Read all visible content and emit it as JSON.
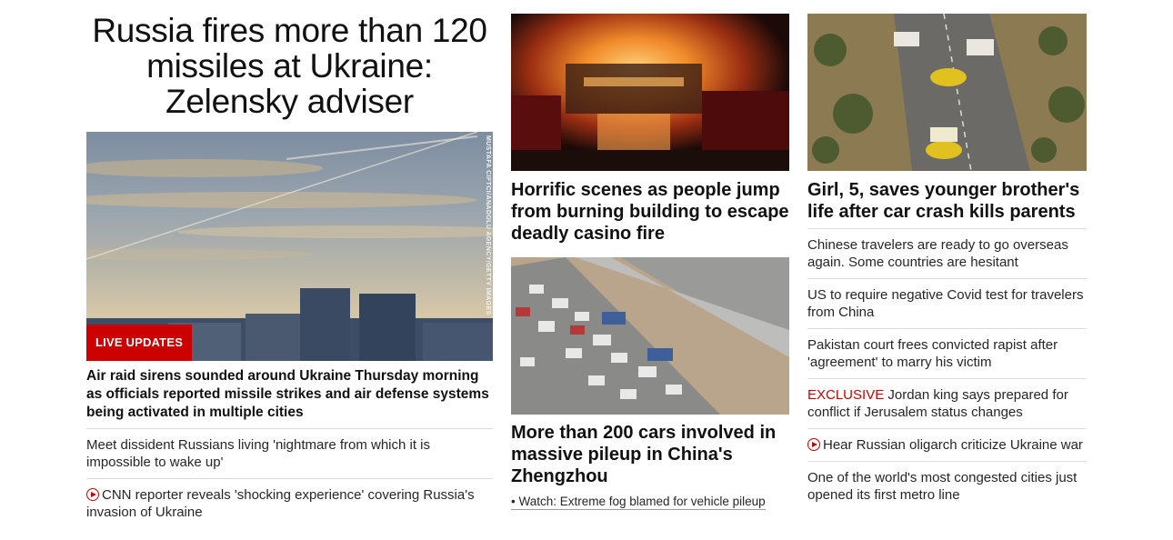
{
  "colors": {
    "accent_red": "#cc0000",
    "text": "#0c0c0c"
  },
  "col1": {
    "headline": "Russia fires more than 120 missiles at Ukraine: Zelensky adviser",
    "image_credit": "MUSTAFA CIFTCI/ANADOLU AGENCY/GETTY IMAGES",
    "badge": "LIVE UPDATES",
    "lead": "Air raid sirens sounded around Ukraine Thursday morning as officials reported missile strikes and air defense systems being activated in multiple cities",
    "stories": [
      "Meet dissident Russians living 'nightmare from which it is impossible to wake up'",
      "CNN reporter reveals 'shocking experience' covering Russia's invasion of Ukraine"
    ]
  },
  "col2": {
    "story1_title": "Horrific scenes as people jump from burning building to escape deadly casino fire",
    "story2_title": "More than 200 cars involved in massive pileup in China's Zhengzhou",
    "watch_link": "• Watch: Extreme fog blamed for vehicle pileup"
  },
  "col3": {
    "story1_title": "Girl, 5, saves younger brother's life after car crash kills parents",
    "stories": [
      "Chinese travelers are ready to go overseas again. Some countries are hesitant",
      "US to require negative Covid test for travelers from China",
      "Pakistan court frees convicted rapist after 'agreement' to marry his victim",
      "Jordan king says prepared for conflict if Jerusalem status changes",
      "Hear Russian oligarch criticize Ukraine war",
      "One of the world's most congested cities just opened its first metro line"
    ],
    "exclusive_label": "EXCLUSIVE"
  }
}
